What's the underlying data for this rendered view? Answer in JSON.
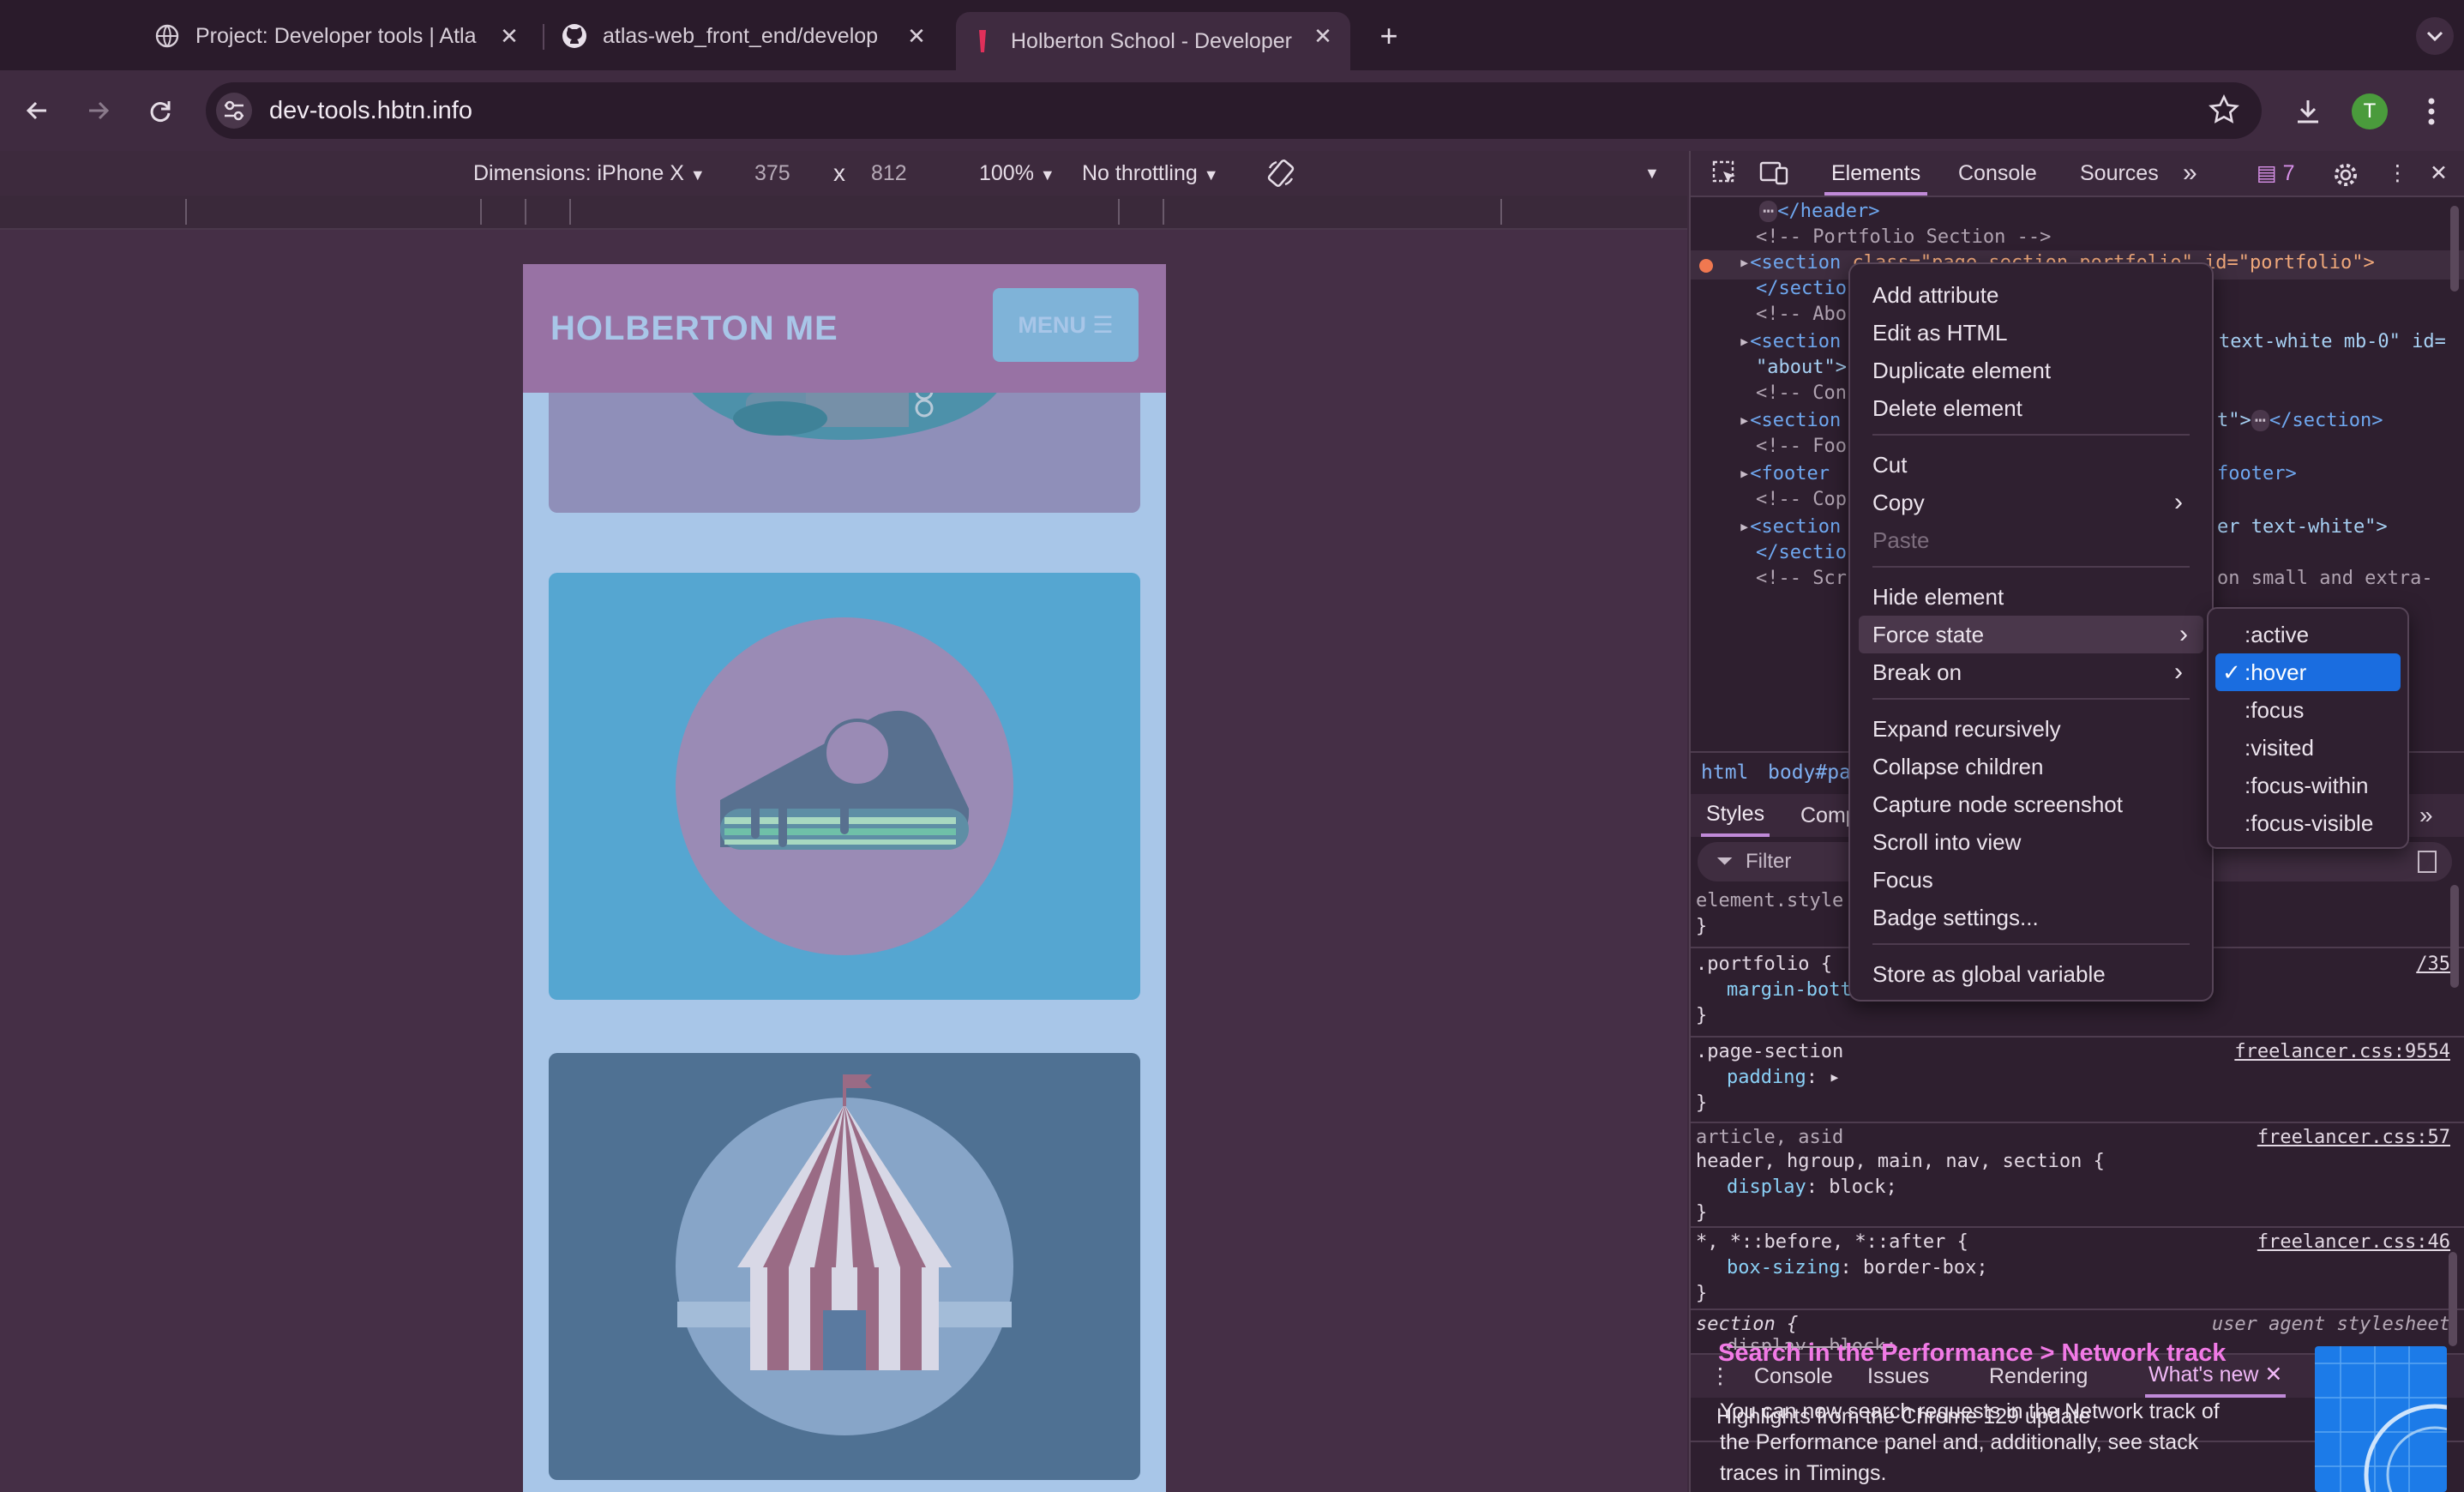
{
  "tabs": [
    {
      "title": "Project: Developer tools | Atla",
      "icon": "globe-icon"
    },
    {
      "title": "atlas-web_front_end/develop",
      "icon": "github-icon"
    },
    {
      "title": "Holberton School - Developer",
      "icon": "holberton-icon"
    }
  ],
  "new_tab_label": "+",
  "address": {
    "url": "dev-tools.hbtn.info"
  },
  "profile": {
    "initial": "T",
    "color": "#4a9b3c"
  },
  "device_toolbar": {
    "dimensions": "Dimensions: iPhone X",
    "width": "375",
    "times": "x",
    "height": "812",
    "zoom": "100%",
    "throttling": "No throttling"
  },
  "page": {
    "brand": "HOLBERTON ME",
    "menu_label": "MENU",
    "colors": {
      "navbar": "#9872a4",
      "background": "#a8c6e8",
      "card_blue": "#55a6d1",
      "card_slate": "#4f7193"
    }
  },
  "devtools": {
    "tabs": [
      "Elements",
      "Console",
      "Sources"
    ],
    "issues_count": "7",
    "dom_lines": {
      "header_close": "</header>",
      "comment_portfolio": "<!-- Portfolio Section -->",
      "section_open": "<section",
      "section_attr": " class=\"page-section portfolio\" id=\"portfolio\">",
      "section_close": "</sectio",
      "comment_about": "<!-- Abo",
      "section2": "<section",
      "section2_tail": "text-white mb-0\" id=",
      "about_val": "\"about\">",
      "comment_con": "<!-- Con",
      "section3": "<section",
      "section3_tail": "t\">",
      "section3_close": "</section>",
      "comment_foo": "<!-- Foo",
      "footer": "<footer",
      "footer_close": "footer>",
      "comment_cop": "<!-- Cop",
      "section4": "<section",
      "section4_tail": "er text-white\">",
      "section4_close": "</sectio",
      "comment_scr": "<!-- Scr",
      "comment_scr_tail": "on small and extra-"
    },
    "breadcrumbs": [
      "html",
      "body#pa"
    ],
    "styles_tabs": [
      "Styles",
      "Comp"
    ],
    "filter_placeholder": "Filter",
    "rules": {
      "element_style": "element.style",
      "portfolio_sel": ".portfolio {",
      "portfolio_prop": "margin-bott",
      "portfolio_src": "/35",
      "page_section_sel": ".page-section",
      "page_section_prop": "padding",
      "page_section_src": "freelancer.css:9554",
      "article_sel1": "article, asid",
      "article_sel2": "header, hgroup, main, nav, section {",
      "article_prop": "display",
      "article_val": "block;",
      "article_src": "freelancer.css:57",
      "universal_sel": "*, *::before, *::after {",
      "universal_prop": "box-sizing",
      "universal_val": "border-box;",
      "universal_src": "freelancer.css:46",
      "section_sel": "section {",
      "section_src": "user agent stylesheet",
      "section_prop": "display: block;",
      "open_brace_close": "}"
    },
    "drawer_tabs": [
      "Console",
      "Issues",
      "Rendering",
      "What's new"
    ],
    "whats_new": {
      "highlight": "Highlights from the Chrome 129 update",
      "heading": "Search in the Performance > Network track",
      "body1": "You can now search requests in the Network track of",
      "body2": "the Performance panel and, additionally, see stack",
      "body3": "traces in Timings."
    }
  },
  "context_menu": {
    "items": [
      "Add attribute",
      "Edit as HTML",
      "Duplicate element",
      "Delete element",
      "Cut",
      "Copy",
      "Paste",
      "Hide element",
      "Force state",
      "Break on",
      "Expand recursively",
      "Collapse children",
      "Capture node screenshot",
      "Scroll into view",
      "Focus",
      "Badge settings...",
      "Store as global variable"
    ],
    "submenu": [
      ":active",
      ":hover",
      ":focus",
      ":visited",
      ":focus-within",
      ":focus-visible"
    ],
    "checkmark": "✓"
  }
}
